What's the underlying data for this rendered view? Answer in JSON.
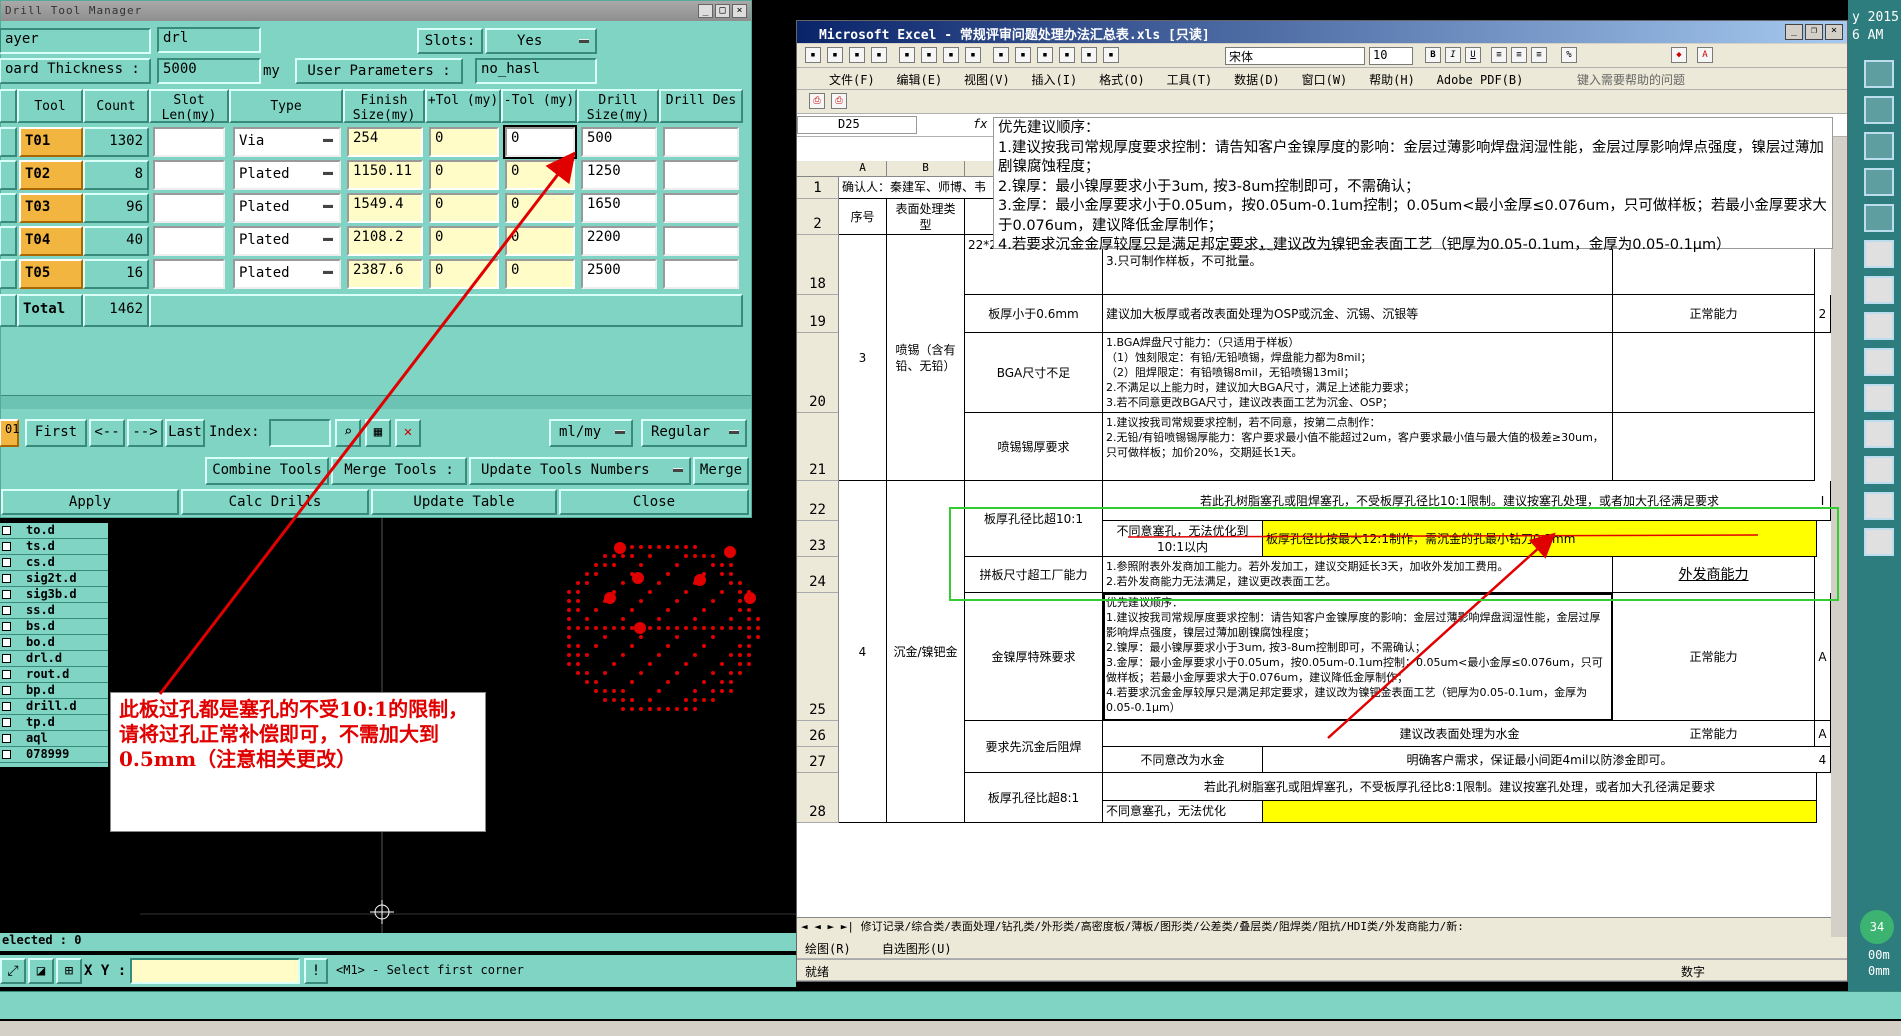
{
  "dtm": {
    "title": "Drill Tool Manager",
    "layer_label": "ayer",
    "layer_value": "drl",
    "slots_label": "Slots:",
    "slots_value": "Yes",
    "board_thickness_label": "oard Thickness :",
    "board_thickness_value": "5000",
    "board_thickness_unit": "my",
    "user_params_label": "User Parameters :",
    "user_params_value": "no_hasl",
    "headers": [
      "Tool",
      "Count",
      "Slot Len(my)",
      "Type",
      "Finish Size(my)",
      "+Tol (my)",
      "-Tol (my)",
      "Drill Size(my)",
      "Drill Des"
    ],
    "rows": [
      {
        "tool": "T01",
        "count": "1302",
        "type": "Via",
        "finish": "254",
        "ptol": "0",
        "ntol": "0",
        "drill": "500"
      },
      {
        "tool": "T02",
        "count": "8",
        "type": "Plated",
        "finish": "1150.11",
        "ptol": "0",
        "ntol": "0",
        "drill": "1250"
      },
      {
        "tool": "T03",
        "count": "96",
        "type": "Plated",
        "finish": "1549.4",
        "ptol": "0",
        "ntol": "0",
        "drill": "1650"
      },
      {
        "tool": "T04",
        "count": "40",
        "type": "Plated",
        "finish": "2108.2",
        "ptol": "0",
        "ntol": "0",
        "drill": "2200"
      },
      {
        "tool": "T05",
        "count": "16",
        "type": "Plated",
        "finish": "2387.6",
        "ptol": "0",
        "ntol": "0",
        "drill": "2500"
      }
    ],
    "total_label": "Total",
    "total_value": "1462",
    "nav": {
      "first": "First",
      "prev": "<--",
      "next": "-->",
      "last": "Last",
      "index": "Index:",
      "unit": "ml/my",
      "regular": "Regular",
      "left_num": "01"
    },
    "buttons": {
      "combine": "Combine Tools",
      "merge": "Merge Tools :",
      "update_nums": "Update Tools Numbers",
      "merge2": "Merge",
      "apply": "Apply",
      "calc": "Calc Drills",
      "update_table": "Update Table",
      "close": "Close"
    }
  },
  "layers": [
    "to.d",
    "ts.d",
    "cs.d",
    "sig2t.d",
    "sig3b.d",
    "ss.d",
    "bs.d",
    "bo.d",
    "drl.d",
    "rout.d",
    "bp.d",
    "drill.d",
    "tp.d",
    "aql",
    "078999"
  ],
  "status": {
    "selected": "elected : 0",
    "xy_label": "X Y :",
    "prompt": "<M1> - Select first corner"
  },
  "annotation": {
    "text": "此板过孔都是塞孔的不受10:1的限制，请将过孔正常补偿即可，不需加大到0.5mm（注意相关更改）",
    "color": "#e00000"
  },
  "excel": {
    "title": "Microsoft Excel - 常规评审问题处理办法汇总表.xls  [只读]",
    "font_name": "宋体",
    "font_size": "10",
    "menus": [
      "文件(F)",
      "编辑(E)",
      "视图(V)",
      "插入(I)",
      "格式(O)",
      "工具(T)",
      "数据(D)",
      "窗口(W)",
      "帮助(H)",
      "Adobe PDF(B)"
    ],
    "help_placeholder": "键入需要帮助的问题",
    "cell_ref": "D25",
    "formula_lines": [
      "优先建议顺序：",
      "1.建议按我司常规厚度要求控制：请告知客户金镍厚度的影响：金层过薄影响焊盘润湿性能，金层过厚影响焊点强度，镍层过薄加剧镍腐蚀程度；",
      "2.镍厚：最小镍厚要求小于3um, 按3-8um控制即可，不需确认；",
      "3.金厚：最小金厚要求小于0.05um，按0.05um-0.1um控制；0.05um<最小金厚≤0.076um，只可做样板；若最小金厚要求大于0.076um，建议降低金厚制作；",
      "4.若要求沉金金厚较厚只是满足邦定要求，建议改为镍钯金表面工艺（钯厚为0.05-0.1um，金厚为0.05-0.1μm）"
    ],
    "col_headers": [
      "A",
      "B"
    ],
    "row1": "确认人：秦建军、师博、韦",
    "row2": {
      "a": "序号",
      "b": "表面处理类型"
    },
    "row_numbers": [
      "1",
      "2",
      "18",
      "19",
      "20",
      "21",
      "22",
      "23",
      "24",
      "25",
      "26",
      "27",
      "28"
    ],
    "r18": {
      "c": "22*24inch",
      "d": "2.若超过最大制作尺寸，建议更改表面工艺；\n3.只可制作样板，不可批量。"
    },
    "r19": {
      "a": "3",
      "b": "喷锡（含有铅、无铅）",
      "c": "板厚小于0.6mm",
      "d": "建议加大板厚或者改表面处理为OSP或沉金、沉锡、沉银等",
      "e": "正常能力",
      "f": "2"
    },
    "r20": {
      "c": "BGA尺寸不足",
      "d": "1.BGA焊盘尺寸能力：（只适用于样板）\n（1）蚀刻限定：有铅/无铅喷锡，焊盘能力都为8mil；\n（2）阻焊限定：有铅喷锡8mil，无铅喷锡13mil；\n2.不满足以上能力时，建议加大BGA尺寸，满足上述能力要求；\n3.若不同意更改BGA尺寸，建议改表面工艺为沉金、OSP；"
    },
    "r21": {
      "c": "喷锡锡厚要求",
      "d": "1.建议按我司常规要求控制，若不同意，按第二点制作：\n2.无铅/有铅喷锡锡厚能力：客户要求最小值不能超过2um，客户要求最小值与最大值的极差≥30um，只可做样板；加价20%，交期延长1天。"
    },
    "r22": {
      "c": "板厚孔径比超10:1",
      "d": "若此孔树脂塞孔或阻焊塞孔，不受板厚孔径比10:1限制。建议按塞孔处理，或者加大孔径满足要求",
      "f": "I"
    },
    "r23": {
      "d": "不同意塞孔，无法优化到10:1以内",
      "e": "板厚孔径比按最大12:1制作，需沉金的孔最小钻刀0.3mm"
    },
    "r24": {
      "c": "拼板尺寸超工厂能力",
      "d": "1.参照附表外发商加工能力。若外发加工，建议交期延长3天，加收外发加工费用。\n2.若外发商能力无法满足，建议更改表面工艺。",
      "e": "外发商能力"
    },
    "r25": {
      "a": "4",
      "b": "沉金/镍钯金",
      "c": "金镍厚特殊要求",
      "d": "优先建议顺序：\n1.建议按我司常规厚度要求控制：请告知客户金镍厚度的影响：金层过薄影响焊盘润湿性能，金层过厚影响焊点强度，镍层过薄加剧镍腐蚀程度；\n2.镍厚：最小镍厚要求小于3um, 按3-8um控制即可，不需确认；\n3.金厚：最小金厚要求小于0.05um，按0.05um-0.1um控制；0.05um<最小金厚≤0.076um，只可做样板；若最小金厚要求大于0.076um，建议降低金厚制作；\n4.若要求沉金金厚较厚只是满足邦定要求，建议改为镍钯金表面工艺（钯厚为0.05-0.1um，金厚为0.05-0.1μm）",
      "e": "正常能力",
      "f": "A"
    },
    "r26": {
      "c": "要求先沉金后阻焊",
      "d": "建议改表面处理为水金",
      "e": "正常能力",
      "f": "A"
    },
    "r27": {
      "d": "不同意改为水金",
      "e": "明确客户需求，保证最小间距4mil以防渗金即可。",
      "f": "4"
    },
    "r28": {
      "c": "板厚孔径比超8:1",
      "d": "若此孔树脂塞孔或阻焊塞孔，不受板厚孔径比8:1限制。建议按塞孔处理，或者加大孔径满足要求",
      "d2": "不同意塞孔，无法优化"
    },
    "sheet_tabs": "修订记录/综合类/表面处理/钻孔类/外形类/高密度板/薄板/图形类/公差类/叠层类/阻焊类/阻抗/HDI类/外发商能力/新:",
    "drawing_label": "绘图(R)",
    "autoshape_label": "自选图形(U)",
    "status_ready": "就绪",
    "status_num": "数字"
  },
  "clock": {
    "line1": "y 2015",
    "line2": "6 AM"
  },
  "right_side": {
    "num": "34",
    "t1": "00m",
    "t2": "0mm"
  }
}
